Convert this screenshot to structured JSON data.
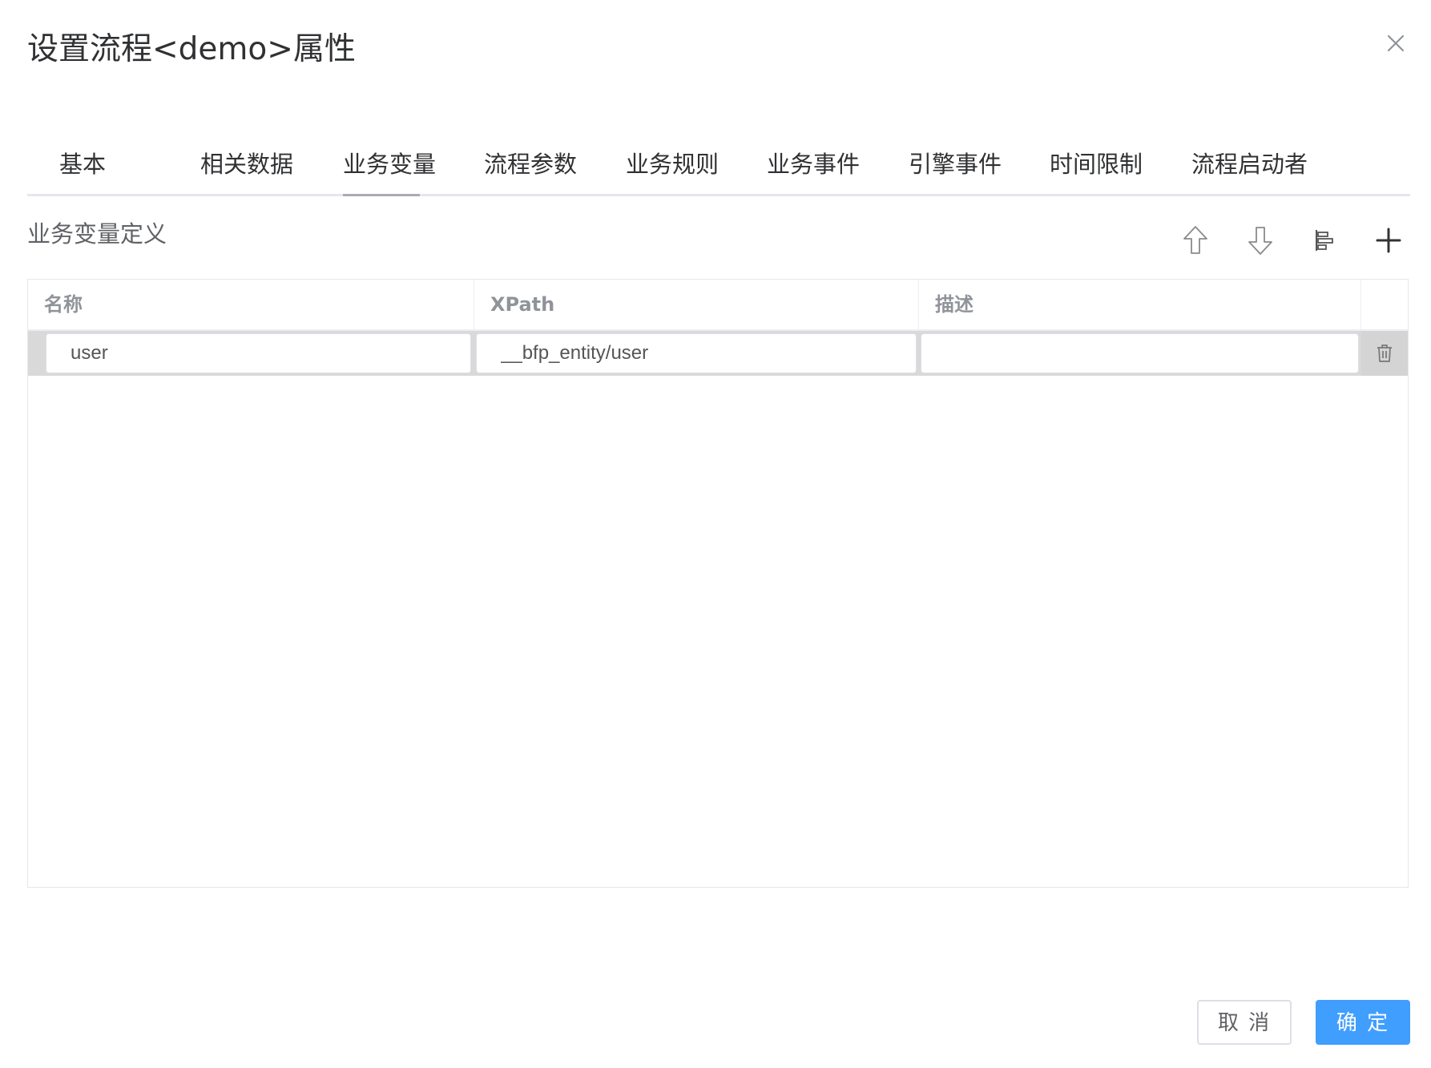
{
  "dialog": {
    "title": "设置流程<demo>属性"
  },
  "tabs": [
    {
      "label": "基本"
    },
    {
      "label": "相关数据"
    },
    {
      "label": "业务变量",
      "active": true
    },
    {
      "label": "流程参数"
    },
    {
      "label": "业务规则"
    },
    {
      "label": "业务事件"
    },
    {
      "label": "引擎事件"
    },
    {
      "label": "时间限制"
    },
    {
      "label": "流程启动者"
    }
  ],
  "section": {
    "title": "业务变量定义",
    "tools": [
      "arrow-up-icon",
      "arrow-down-icon",
      "align-left-icon",
      "plus-icon"
    ]
  },
  "grid": {
    "columns": [
      "名称",
      "XPath",
      "描述"
    ],
    "rows": [
      {
        "name": "user",
        "xpath": "__bfp_entity/user",
        "description": ""
      }
    ]
  },
  "footer": {
    "cancel_label": "取 消",
    "ok_label": "确 定"
  },
  "colors": {
    "primary": "#409eff",
    "row_bg": "#d9d9d9",
    "border": "#e4e7ed"
  }
}
